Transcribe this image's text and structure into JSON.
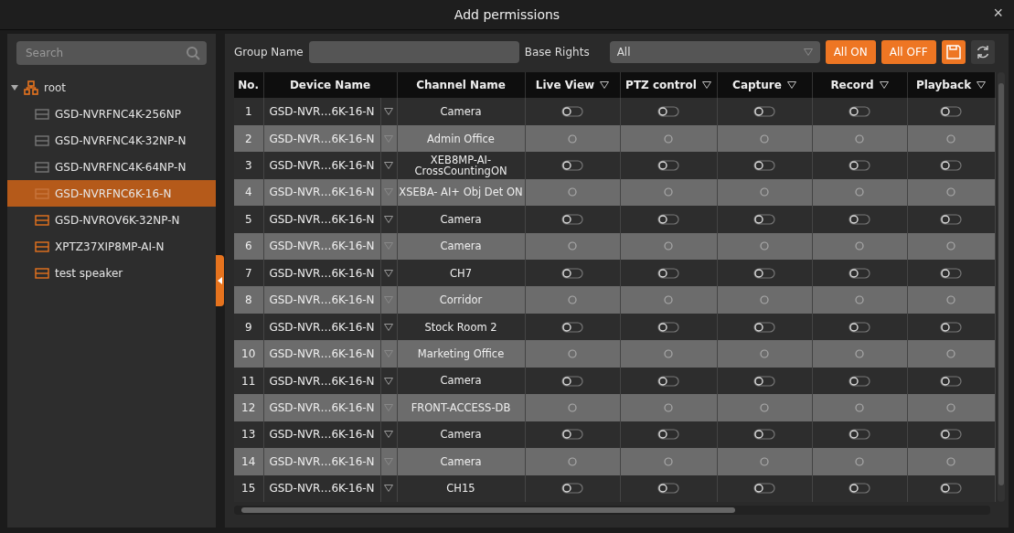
{
  "window": {
    "title": "Add permissions",
    "close": "×"
  },
  "sidebar": {
    "search": {
      "placeholder": "Search"
    },
    "tree": [
      {
        "label": "root",
        "expanded": true,
        "children": [
          {
            "label": "GSD-NVRFNC4K-256NP",
            "online": false,
            "selected": false
          },
          {
            "label": "GSD-NVRFNC4K-32NP-N",
            "online": false,
            "selected": false
          },
          {
            "label": "GSD-NVRFNC4K-64NP-N",
            "online": false,
            "selected": false
          },
          {
            "label": "GSD-NVRFNC6K-16-N",
            "online": false,
            "selected": true
          },
          {
            "label": "GSD-NVROV6K-32NP-N",
            "online": true,
            "selected": false
          },
          {
            "label": "XPTZ37XIP8MP-AI-N",
            "online": true,
            "selected": false
          },
          {
            "label": "test speaker",
            "online": true,
            "selected": false
          }
        ]
      }
    ]
  },
  "toolbar": {
    "group_name": {
      "label": "Group Name"
    },
    "base_rights": {
      "label": "Base Rights",
      "value": "All"
    },
    "buttons": [
      "All ON",
      "All OFF"
    ]
  },
  "table": {
    "columns": [
      "No.",
      "Device Name",
      "Channel Name",
      "Live View",
      "PTZ control",
      "Capture",
      "Record",
      "Playback"
    ],
    "rows": [
      {
        "no": "1",
        "device": "GSD-NVR…6K-16-N",
        "channel": "Camera",
        "perms": [
          false,
          false,
          false,
          false,
          false
        ]
      },
      {
        "no": "2",
        "device": "GSD-NVR…6K-16-N",
        "channel": "Admin Office",
        "perms": [
          false,
          false,
          false,
          false,
          false
        ]
      },
      {
        "no": "3",
        "device": "GSD-NVR…6K-16-N",
        "channel": "XEB8MP-AI-CrossCountingON",
        "perms": [
          false,
          false,
          false,
          false,
          false
        ]
      },
      {
        "no": "4",
        "device": "GSD-NVR…6K-16-N",
        "channel": "XSEBA- AI+ Obj Det ON",
        "perms": [
          false,
          false,
          false,
          false,
          false
        ]
      },
      {
        "no": "5",
        "device": "GSD-NVR…6K-16-N",
        "channel": "Camera",
        "perms": [
          false,
          false,
          false,
          false,
          false
        ]
      },
      {
        "no": "6",
        "device": "GSD-NVR…6K-16-N",
        "channel": "Camera",
        "perms": [
          false,
          false,
          false,
          false,
          false
        ]
      },
      {
        "no": "7",
        "device": "GSD-NVR…6K-16-N",
        "channel": "CH7",
        "perms": [
          false,
          false,
          false,
          false,
          false
        ]
      },
      {
        "no": "8",
        "device": "GSD-NVR…6K-16-N",
        "channel": "Corridor",
        "perms": [
          false,
          false,
          false,
          false,
          false
        ]
      },
      {
        "no": "9",
        "device": "GSD-NVR…6K-16-N",
        "channel": "Stock Room 2",
        "perms": [
          false,
          false,
          false,
          false,
          false
        ]
      },
      {
        "no": "10",
        "device": "GSD-NVR…6K-16-N",
        "channel": "Marketing Office",
        "perms": [
          false,
          false,
          false,
          false,
          false
        ]
      },
      {
        "no": "11",
        "device": "GSD-NVR…6K-16-N",
        "channel": "Camera",
        "perms": [
          false,
          false,
          false,
          false,
          false
        ]
      },
      {
        "no": "12",
        "device": "GSD-NVR…6K-16-N",
        "channel": "FRONT-ACCESS-DB",
        "perms": [
          false,
          false,
          false,
          false,
          false
        ]
      },
      {
        "no": "13",
        "device": "GSD-NVR…6K-16-N",
        "channel": "Camera",
        "perms": [
          false,
          false,
          false,
          false,
          false
        ]
      },
      {
        "no": "14",
        "device": "GSD-NVR…6K-16-N",
        "channel": "Camera",
        "perms": [
          false,
          false,
          false,
          false,
          false
        ]
      },
      {
        "no": "15",
        "device": "GSD-NVR…6K-16-N",
        "channel": "CH15",
        "perms": [
          false,
          false,
          false,
          false,
          false
        ]
      }
    ]
  }
}
